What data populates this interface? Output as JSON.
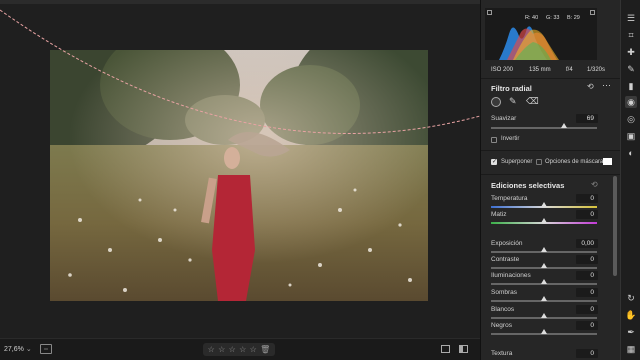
{
  "canvas": {
    "zoom": "27,6%"
  },
  "rating": {
    "stars": [
      "☆",
      "☆",
      "☆",
      "☆",
      "☆"
    ],
    "trash_icon": "trash-icon"
  },
  "histogram": {
    "r_label": "R: 40",
    "g_label": "G: 33",
    "b_label": "B: 29"
  },
  "camera": {
    "iso": "ISO 200",
    "focal": "135 mm",
    "aperture": "f/4",
    "shutter": "1/320s"
  },
  "radial_filter": {
    "title": "Filtro radial",
    "feather_label": "Suavizar",
    "feather_value": "69",
    "feather_level": 0.69,
    "invert_label": "Invertir",
    "overlay_label": "Superponer",
    "mask_options_label": "Opciones de máscara"
  },
  "selective_edits": {
    "title": "Ediciones selectivas",
    "sliders": [
      {
        "label": "Temperatura",
        "value": "0",
        "level": 0.5,
        "track": "temp"
      },
      {
        "label": "Matiz",
        "value": "0",
        "level": 0.5,
        "track": "tint"
      },
      {
        "label": "Exposición",
        "value": "0,00",
        "level": 0.5,
        "track": "plain"
      },
      {
        "label": "Contraste",
        "value": "0",
        "level": 0.5,
        "track": "plain"
      },
      {
        "label": "Iluminaciones",
        "value": "0",
        "level": 0.5,
        "track": "plain"
      },
      {
        "label": "Sombras",
        "value": "0",
        "level": 0.5,
        "track": "plain"
      },
      {
        "label": "Blancos",
        "value": "0",
        "level": 0.5,
        "track": "plain"
      },
      {
        "label": "Negros",
        "value": "0",
        "level": 0.5,
        "track": "plain"
      },
      {
        "label": "Textura",
        "value": "0",
        "level": 0.5,
        "track": "plain"
      }
    ]
  },
  "colors": {
    "accent": "#2d8ceb",
    "panel": "#262626",
    "mask_outline": "#e8a3a3"
  }
}
